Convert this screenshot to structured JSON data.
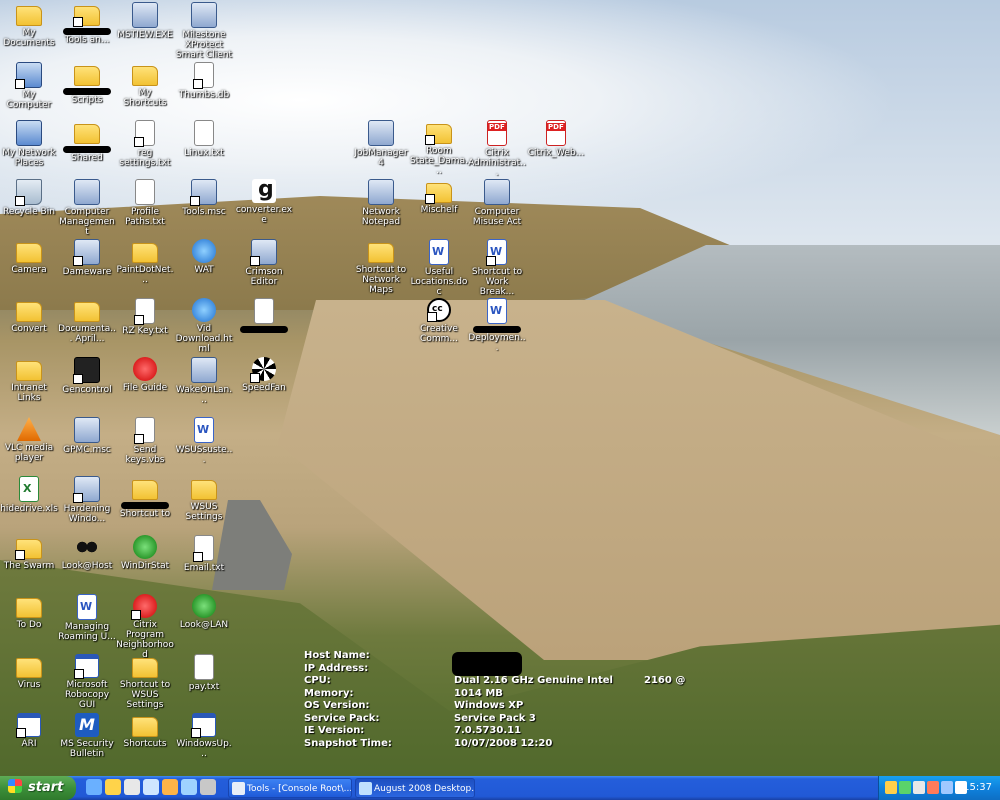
{
  "desktop": {
    "icons": [
      {
        "label": "My Documents",
        "glyph": "g-folder",
        "icon": "my-documents-icon"
      },
      {
        "label": "Tools an...",
        "glyph": "g-folder",
        "icon": "folder-icon",
        "redacted": true
      },
      {
        "label": "MSTIEW.EXE",
        "glyph": "g-app",
        "icon": "application-icon"
      },
      {
        "label": "Milestone XProtect Smart Client",
        "glyph": "g-app",
        "icon": "milestone-icon"
      },
      {
        "label": "My Computer",
        "glyph": "g-comp",
        "icon": "my-computer-icon"
      },
      {
        "label": "Scripts",
        "glyph": "g-folder",
        "icon": "folder-icon",
        "redacted": true
      },
      {
        "label": "My Shortcuts",
        "glyph": "g-folder",
        "icon": "folder-icon"
      },
      {
        "label": "Thumbs.db",
        "glyph": "g-doc",
        "icon": "file-icon"
      },
      {
        "label": "My Network Places",
        "glyph": "g-comp",
        "icon": "network-places-icon"
      },
      {
        "label": "Shared",
        "glyph": "g-folder",
        "icon": "shared-folder-icon",
        "redacted": true
      },
      {
        "label": "reg settings.txt",
        "glyph": "g-doc",
        "icon": "text-file-icon"
      },
      {
        "label": "Linux.txt",
        "glyph": "g-doc",
        "icon": "text-file-icon"
      },
      {
        "label": "JobManager4",
        "glyph": "g-app",
        "icon": "jobmanager-icon"
      },
      {
        "label": "Room State_Dama...",
        "glyph": "g-folder",
        "icon": "folder-icon"
      },
      {
        "label": "Citrix Administrat...",
        "glyph": "g-pdf",
        "icon": "pdf-icon"
      },
      {
        "label": "Citrix_Web...",
        "glyph": "g-pdf",
        "icon": "pdf-icon"
      },
      {
        "label": "Recycle Bin",
        "glyph": "g-bin",
        "icon": "recycle-bin-icon"
      },
      {
        "label": "Computer Management",
        "glyph": "g-app",
        "icon": "computer-management-icon"
      },
      {
        "label": "Profile Paths.txt",
        "glyph": "g-doc",
        "icon": "text-file-icon"
      },
      {
        "label": "Tools.msc",
        "glyph": "g-app",
        "icon": "msc-icon"
      },
      {
        "label": "converter.exe",
        "glyph": "g-g",
        "icon": "converter-icon"
      },
      {
        "label": "Network Notepad",
        "glyph": "g-app",
        "icon": "network-notepad-icon"
      },
      {
        "label": "Mischelf",
        "glyph": "g-folder",
        "icon": "folder-icon"
      },
      {
        "label": "Computer Misuse Act",
        "glyph": "g-app",
        "icon": "computer-misuse-act-icon"
      },
      {
        "label": "Camera",
        "glyph": "g-folder",
        "icon": "folder-icon"
      },
      {
        "label": "Dameware",
        "glyph": "g-app",
        "icon": "dameware-icon"
      },
      {
        "label": "PaintDotNet...",
        "glyph": "g-folder",
        "icon": "folder-icon"
      },
      {
        "label": "WAT",
        "glyph": "g-ie",
        "icon": "internet-explorer-icon"
      },
      {
        "label": "Crimson Editor",
        "glyph": "g-app",
        "icon": "crimson-editor-icon"
      },
      {
        "label": "Shortcut to Network Maps",
        "glyph": "g-folder",
        "icon": "folder-icon"
      },
      {
        "label": "Useful Locations.doc",
        "glyph": "g-word",
        "icon": "word-document-icon"
      },
      {
        "label": "Shortcut to Work Break...",
        "glyph": "g-word",
        "icon": "word-document-icon"
      },
      {
        "label": "Convert",
        "glyph": "g-folder",
        "icon": "folder-icon"
      },
      {
        "label": "Documenta... April...",
        "glyph": "g-folder",
        "icon": "folder-icon"
      },
      {
        "label": "RZ Key.txt",
        "glyph": "g-doc",
        "icon": "text-file-icon"
      },
      {
        "label": "Vid Download.html",
        "glyph": "g-ie",
        "icon": "html-file-icon"
      },
      {
        "label": "",
        "glyph": "g-doc",
        "icon": "file-icon",
        "redacted": true
      },
      {
        "label": "Creative Comm...",
        "glyph": "g-cc",
        "icon": "creative-commons-icon"
      },
      {
        "label": "Deploymen...",
        "glyph": "g-word",
        "icon": "word-document-icon",
        "redacted": true
      },
      {
        "label": "Intranet Links",
        "glyph": "g-folder",
        "icon": "folder-icon"
      },
      {
        "label": "Gencontrol",
        "glyph": "g-dark",
        "icon": "gencontrol-icon"
      },
      {
        "label": "File Guide",
        "glyph": "g-red",
        "icon": "file-guide-icon"
      },
      {
        "label": "WakeOnLan...",
        "glyph": "g-app",
        "icon": "wake-on-lan-icon"
      },
      {
        "label": "SpeedFan",
        "glyph": "g-fan",
        "icon": "speedfan-icon"
      },
      {
        "label": "VLC media player",
        "glyph": "g-vlc",
        "icon": "vlc-icon"
      },
      {
        "label": "GPMC.msc",
        "glyph": "g-app",
        "icon": "msc-icon"
      },
      {
        "label": "Send keys.vbs",
        "glyph": "g-doc",
        "icon": "script-file-icon"
      },
      {
        "label": "WSUSsuste...",
        "glyph": "g-word",
        "icon": "word-document-icon"
      },
      {
        "label": "hidedrive.xls",
        "glyph": "g-excel",
        "icon": "excel-file-icon"
      },
      {
        "label": "Hardening Windo...",
        "glyph": "g-app",
        "icon": "hardening-windows-icon"
      },
      {
        "label": "Shortcut to",
        "glyph": "g-folder",
        "icon": "folder-icon",
        "redacted": true
      },
      {
        "label": "WSUS Settings",
        "glyph": "g-folder",
        "icon": "folder-icon"
      },
      {
        "label": "The Swarm",
        "glyph": "g-folder",
        "icon": "folder-icon"
      },
      {
        "label": "Look@Host",
        "glyph": "g-dots",
        "icon": "look-at-host-icon"
      },
      {
        "label": "WinDirStat",
        "glyph": "g-green",
        "icon": "windirstat-icon"
      },
      {
        "label": "Email.txt",
        "glyph": "g-doc",
        "icon": "text-file-icon"
      },
      {
        "label": "To Do",
        "glyph": "g-folder",
        "icon": "folder-icon"
      },
      {
        "label": "Managing Roaming U...",
        "glyph": "g-word",
        "icon": "word-document-icon"
      },
      {
        "label": "Citrix Program Neighborhood",
        "glyph": "g-red",
        "icon": "citrix-icon"
      },
      {
        "label": "Look@LAN",
        "glyph": "g-green",
        "icon": "look-at-lan-icon"
      },
      {
        "label": "Virus",
        "glyph": "g-folder",
        "icon": "folder-icon"
      },
      {
        "label": "Microsoft Robocopy GUI",
        "glyph": "g-window",
        "icon": "robocopy-icon"
      },
      {
        "label": "Shortcut to WSUS Settings",
        "glyph": "g-folder",
        "icon": "folder-icon"
      },
      {
        "label": "pay.txt",
        "glyph": "g-doc",
        "icon": "text-file-icon"
      },
      {
        "label": "ARI",
        "glyph": "g-window",
        "icon": "application-icon"
      },
      {
        "label": "MS Security Bulletin",
        "glyph": "g-m",
        "icon": "ms-security-icon"
      },
      {
        "label": "Shortcuts",
        "glyph": "g-folder",
        "icon": "folder-icon"
      },
      {
        "label": "WindowsUp...",
        "glyph": "g-window",
        "icon": "windows-update-icon"
      }
    ]
  },
  "sysinfo": [
    {
      "key": "Host Name:",
      "value": "",
      "extra": ""
    },
    {
      "key": "IP Address:",
      "value": "",
      "extra": ""
    },
    {
      "key": "CPU:",
      "value": "Dual 2.16 GHz Genuine Intel",
      "extra": "2160 @"
    },
    {
      "key": "Memory:",
      "value": "1014 MB",
      "extra": ""
    },
    {
      "key": "OS Version:",
      "value": "Windows XP",
      "extra": ""
    },
    {
      "key": "Service Pack:",
      "value": "Service Pack 3",
      "extra": ""
    },
    {
      "key": "IE Version:",
      "value": "7.0.5730.11",
      "extra": ""
    },
    {
      "key": "Snapshot Time:",
      "value": "10/07/2008 12:20",
      "extra": ""
    }
  ],
  "taskbar": {
    "start_label": "start",
    "tasks": [
      {
        "label": "Tools - [Console Root\\...",
        "active": false
      },
      {
        "label": "August 2008 Desktop...",
        "active": true
      }
    ],
    "clock": "15:37"
  },
  "colors": {
    "taskbar_blue": "#245edb",
    "start_green": "#3c8f3a",
    "tray_blue": "#0f82dd"
  }
}
